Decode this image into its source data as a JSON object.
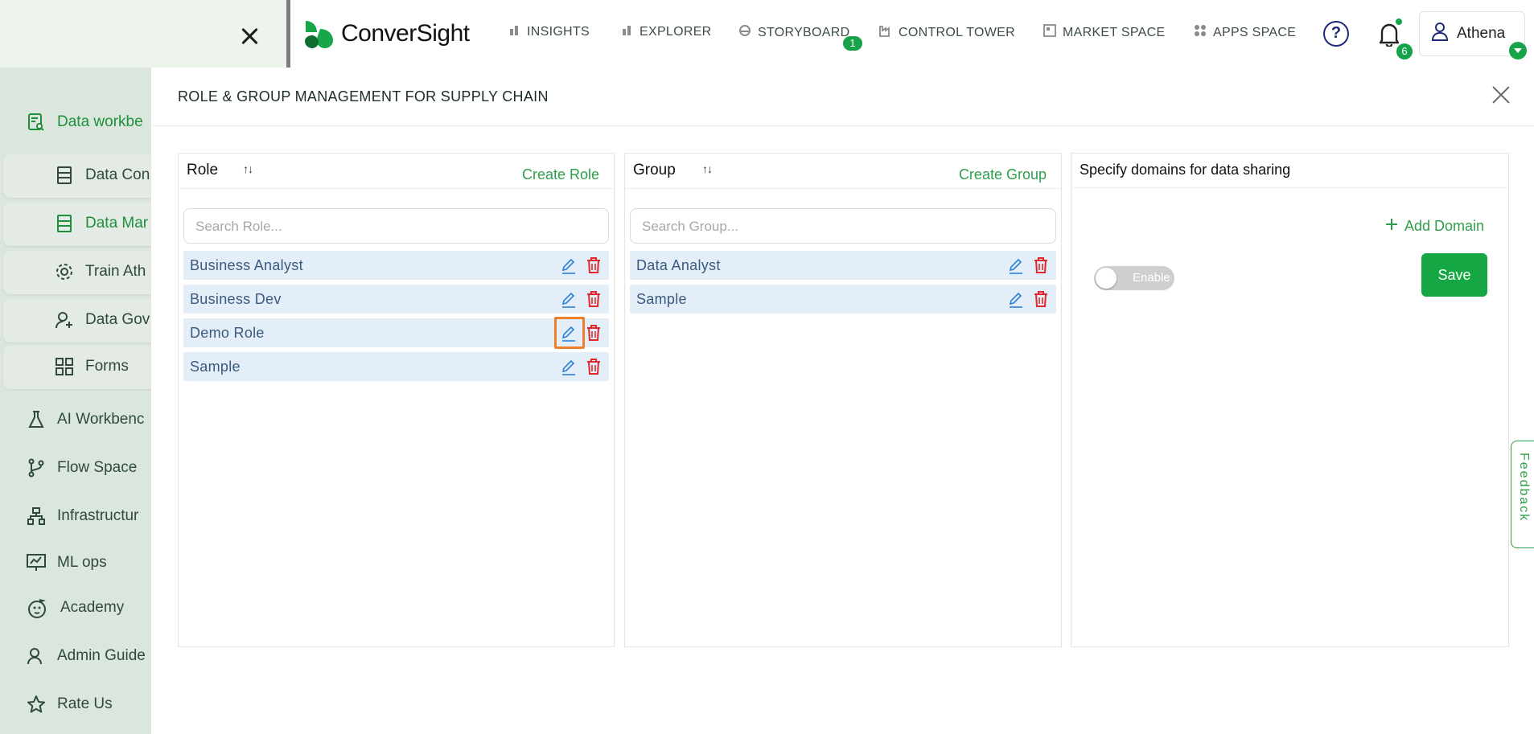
{
  "app": {
    "brand": "ConverSight",
    "accent": "#17a34a"
  },
  "sidebar": {
    "items": [
      {
        "label": "Data workbe",
        "icon": "document-search-icon",
        "active": true
      },
      {
        "label": "AI Workbenc",
        "icon": "flask-icon"
      },
      {
        "label": "Flow Space",
        "icon": "branch-icon"
      },
      {
        "label": "Infrastructur",
        "icon": "hierarchy-icon"
      },
      {
        "label": "ML ops",
        "icon": "chart-monitor-icon"
      },
      {
        "label": "Academy",
        "icon": "mascot-icon"
      },
      {
        "label": "Admin Guide",
        "icon": "user-guide-icon"
      },
      {
        "label": "Rate Us",
        "icon": "star-icon"
      }
    ],
    "subitems": [
      {
        "label": "Data Con",
        "icon": "database-icon"
      },
      {
        "label": "Data Mar",
        "icon": "database-icon",
        "active": true
      },
      {
        "label": "Train Ath",
        "icon": "gear-icon"
      },
      {
        "label": "Data Gov",
        "icon": "user-plus-icon"
      },
      {
        "label": "Forms",
        "icon": "grid-icon"
      }
    ]
  },
  "topnav": {
    "items": [
      "INSIGHTS",
      "EXPLORER",
      "STORYBOARD",
      "CONTROL TOWER",
      "MARKET SPACE",
      "APPS SPACE"
    ],
    "storyboard_badge": "1",
    "notification_count": "6",
    "help_symbol": "?",
    "user_name": "Athena"
  },
  "panel": {
    "title": "ROLE & GROUP MANAGEMENT FOR SUPPLY CHAIN",
    "role": {
      "title": "Role",
      "action": "Create Role",
      "placeholder": "Search Role...",
      "rows": [
        "Business Analyst",
        "Business Dev",
        "Demo Role",
        "Sample"
      ],
      "highlighted_row": 2
    },
    "group": {
      "title": "Group",
      "action": "Create Group",
      "placeholder": "Search Group...",
      "rows": [
        "Data Analyst",
        "Sample"
      ]
    },
    "domains": {
      "title": "Specify domains for data sharing",
      "add_label": "Add Domain",
      "toggle_label": "Enable",
      "toggle_on": false,
      "save_label": "Save"
    }
  },
  "feedback_label": "Feedback"
}
